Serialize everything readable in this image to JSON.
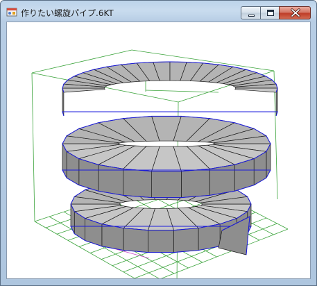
{
  "window": {
    "title": "作りたい螺旋パイプ.6KT",
    "app_icon": "shade-app-icon",
    "minimize_icon": "minimize-icon",
    "maximize_icon": "maximize-icon",
    "close_icon": "close-icon",
    "accent_close": "#c94a33"
  },
  "viewport": {
    "content": "3d-helical-pipe-render",
    "colors": {
      "face": "#b4b4b4",
      "face_light": "#c6c6c6",
      "face_dark": "#8e8e8e",
      "edge": "#1a1a1a",
      "silhouette": "#1a1adc",
      "grid": "#3aa33a",
      "axis": "#cc44cc"
    }
  }
}
